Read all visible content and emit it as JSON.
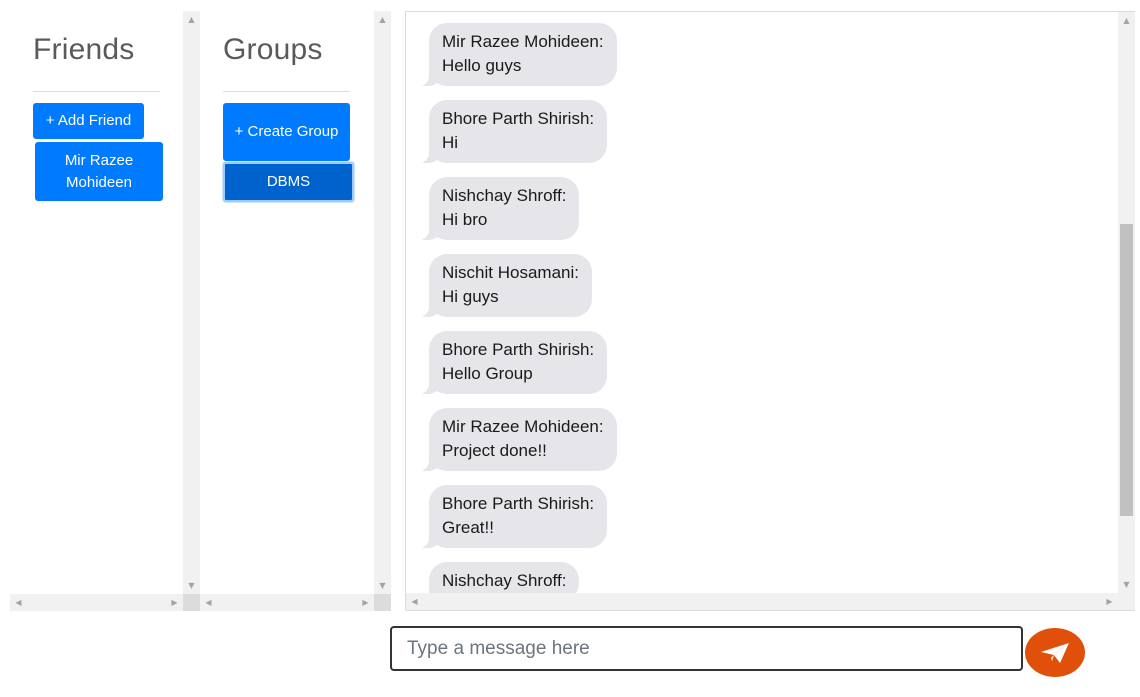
{
  "friends": {
    "title": "Friends",
    "add_button_label": "+ Add Friend",
    "items": [
      {
        "label": "Mir Razee Mohideen"
      }
    ]
  },
  "groups": {
    "title": "Groups",
    "create_button_label": "+ Create Group",
    "items": [
      {
        "label": "DBMS",
        "selected": true
      }
    ]
  },
  "chat": {
    "messages": [
      {
        "sender": "Mir Razee Mohideen:",
        "text": "Hello guys"
      },
      {
        "sender": "Bhore Parth Shirish:",
        "text": "Hi"
      },
      {
        "sender": "Nishchay Shroff:",
        "text": "Hi bro"
      },
      {
        "sender": "Nischit Hosamani:",
        "text": "Hi guys"
      },
      {
        "sender": "Bhore Parth Shirish:",
        "text": "Hello Group"
      },
      {
        "sender": "Mir Razee Mohideen:",
        "text": "Project done!!"
      },
      {
        "sender": "Bhore Parth Shirish:",
        "text": "Great!!"
      },
      {
        "sender": "Nishchay Shroff:",
        "text": ""
      }
    ]
  },
  "composer": {
    "placeholder": "Type a message here",
    "value": "",
    "send_icon": "paper-plane-icon"
  },
  "colors": {
    "primary_button": "#007bff",
    "selected_button": "#0062cc",
    "message_bubble": "#e5e5ea",
    "send_button": "#e0500b"
  }
}
